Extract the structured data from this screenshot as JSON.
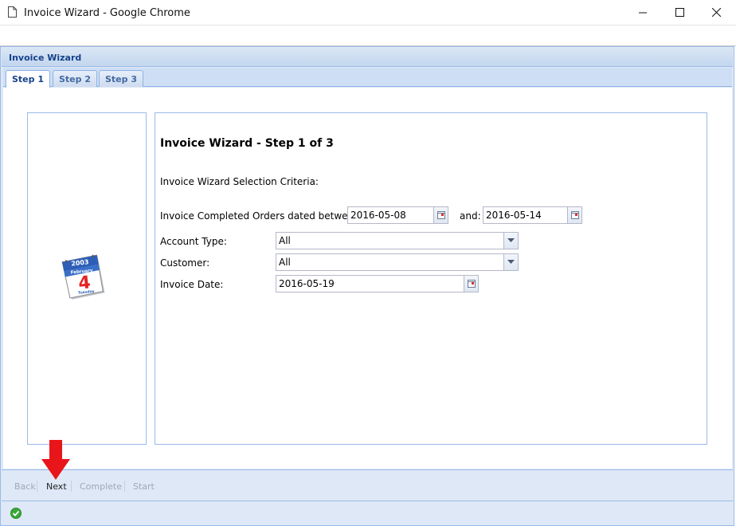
{
  "window": {
    "title": "Invoice Wizard - Google Chrome",
    "icons": {
      "document": "document-icon",
      "minimize": "minimize-icon",
      "maximize": "maximize-icon",
      "close": "close-icon"
    }
  },
  "panel": {
    "title": "Invoice Wizard"
  },
  "tabs": [
    {
      "label": "Step 1",
      "active": true
    },
    {
      "label": "Step 2",
      "active": false
    },
    {
      "label": "Step 3",
      "active": false
    }
  ],
  "calendar_image": {
    "year": "2003",
    "month": "February",
    "day": "4",
    "weekday": "Tuesday"
  },
  "form": {
    "heading": "Invoice Wizard - Step 1 of 3",
    "criteria_label": "Invoice Wizard Selection Criteria:",
    "orders_label": "Invoice Completed Orders dated between:",
    "date_from": "2016-05-08",
    "and_label": "and:",
    "date_to": "2016-05-14",
    "account_type_label": "Account Type:",
    "account_type_value": "All",
    "customer_label": "Customer:",
    "customer_value": "All",
    "invoice_date_label": "Invoice Date:",
    "invoice_date_value": "2016-05-19"
  },
  "footer": {
    "back": "Back",
    "next": "Next",
    "complete": "Complete",
    "start": "Start"
  },
  "colors": {
    "accent": "#15428b",
    "panel_border": "#99bbe8",
    "arrow": "#e8161a"
  }
}
